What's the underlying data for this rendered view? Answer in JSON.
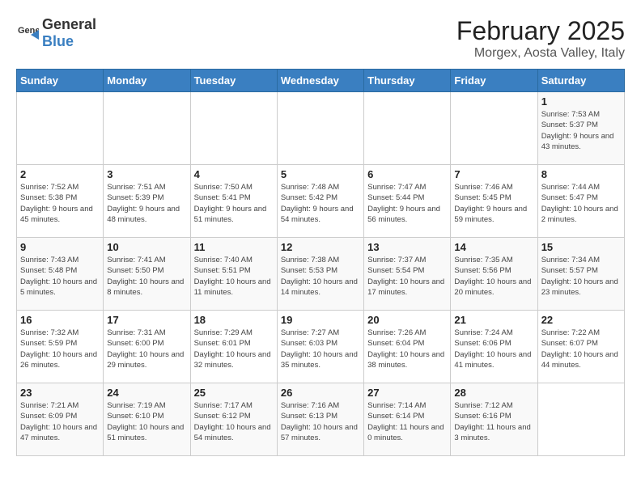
{
  "logo": {
    "text_general": "General",
    "text_blue": "Blue"
  },
  "title": "February 2025",
  "subtitle": "Morgex, Aosta Valley, Italy",
  "weekdays": [
    "Sunday",
    "Monday",
    "Tuesday",
    "Wednesday",
    "Thursday",
    "Friday",
    "Saturday"
  ],
  "weeks": [
    [
      {
        "day": "",
        "info": ""
      },
      {
        "day": "",
        "info": ""
      },
      {
        "day": "",
        "info": ""
      },
      {
        "day": "",
        "info": ""
      },
      {
        "day": "",
        "info": ""
      },
      {
        "day": "",
        "info": ""
      },
      {
        "day": "1",
        "info": "Sunrise: 7:53 AM\nSunset: 5:37 PM\nDaylight: 9 hours and 43 minutes."
      }
    ],
    [
      {
        "day": "2",
        "info": "Sunrise: 7:52 AM\nSunset: 5:38 PM\nDaylight: 9 hours and 45 minutes."
      },
      {
        "day": "3",
        "info": "Sunrise: 7:51 AM\nSunset: 5:39 PM\nDaylight: 9 hours and 48 minutes."
      },
      {
        "day": "4",
        "info": "Sunrise: 7:50 AM\nSunset: 5:41 PM\nDaylight: 9 hours and 51 minutes."
      },
      {
        "day": "5",
        "info": "Sunrise: 7:48 AM\nSunset: 5:42 PM\nDaylight: 9 hours and 54 minutes."
      },
      {
        "day": "6",
        "info": "Sunrise: 7:47 AM\nSunset: 5:44 PM\nDaylight: 9 hours and 56 minutes."
      },
      {
        "day": "7",
        "info": "Sunrise: 7:46 AM\nSunset: 5:45 PM\nDaylight: 9 hours and 59 minutes."
      },
      {
        "day": "8",
        "info": "Sunrise: 7:44 AM\nSunset: 5:47 PM\nDaylight: 10 hours and 2 minutes."
      }
    ],
    [
      {
        "day": "9",
        "info": "Sunrise: 7:43 AM\nSunset: 5:48 PM\nDaylight: 10 hours and 5 minutes."
      },
      {
        "day": "10",
        "info": "Sunrise: 7:41 AM\nSunset: 5:50 PM\nDaylight: 10 hours and 8 minutes."
      },
      {
        "day": "11",
        "info": "Sunrise: 7:40 AM\nSunset: 5:51 PM\nDaylight: 10 hours and 11 minutes."
      },
      {
        "day": "12",
        "info": "Sunrise: 7:38 AM\nSunset: 5:53 PM\nDaylight: 10 hours and 14 minutes."
      },
      {
        "day": "13",
        "info": "Sunrise: 7:37 AM\nSunset: 5:54 PM\nDaylight: 10 hours and 17 minutes."
      },
      {
        "day": "14",
        "info": "Sunrise: 7:35 AM\nSunset: 5:56 PM\nDaylight: 10 hours and 20 minutes."
      },
      {
        "day": "15",
        "info": "Sunrise: 7:34 AM\nSunset: 5:57 PM\nDaylight: 10 hours and 23 minutes."
      }
    ],
    [
      {
        "day": "16",
        "info": "Sunrise: 7:32 AM\nSunset: 5:59 PM\nDaylight: 10 hours and 26 minutes."
      },
      {
        "day": "17",
        "info": "Sunrise: 7:31 AM\nSunset: 6:00 PM\nDaylight: 10 hours and 29 minutes."
      },
      {
        "day": "18",
        "info": "Sunrise: 7:29 AM\nSunset: 6:01 PM\nDaylight: 10 hours and 32 minutes."
      },
      {
        "day": "19",
        "info": "Sunrise: 7:27 AM\nSunset: 6:03 PM\nDaylight: 10 hours and 35 minutes."
      },
      {
        "day": "20",
        "info": "Sunrise: 7:26 AM\nSunset: 6:04 PM\nDaylight: 10 hours and 38 minutes."
      },
      {
        "day": "21",
        "info": "Sunrise: 7:24 AM\nSunset: 6:06 PM\nDaylight: 10 hours and 41 minutes."
      },
      {
        "day": "22",
        "info": "Sunrise: 7:22 AM\nSunset: 6:07 PM\nDaylight: 10 hours and 44 minutes."
      }
    ],
    [
      {
        "day": "23",
        "info": "Sunrise: 7:21 AM\nSunset: 6:09 PM\nDaylight: 10 hours and 47 minutes."
      },
      {
        "day": "24",
        "info": "Sunrise: 7:19 AM\nSunset: 6:10 PM\nDaylight: 10 hours and 51 minutes."
      },
      {
        "day": "25",
        "info": "Sunrise: 7:17 AM\nSunset: 6:12 PM\nDaylight: 10 hours and 54 minutes."
      },
      {
        "day": "26",
        "info": "Sunrise: 7:16 AM\nSunset: 6:13 PM\nDaylight: 10 hours and 57 minutes."
      },
      {
        "day": "27",
        "info": "Sunrise: 7:14 AM\nSunset: 6:14 PM\nDaylight: 11 hours and 0 minutes."
      },
      {
        "day": "28",
        "info": "Sunrise: 7:12 AM\nSunset: 6:16 PM\nDaylight: 11 hours and 3 minutes."
      },
      {
        "day": "",
        "info": ""
      }
    ]
  ]
}
